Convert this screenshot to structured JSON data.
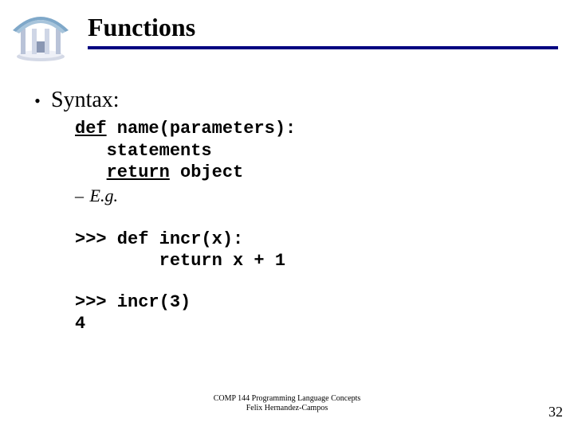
{
  "title": "Functions",
  "bullet": "•",
  "syntax_label": "Syntax:",
  "code": {
    "def": "def",
    "sig": " name(parameters):",
    "stmts": "statements",
    "ret": "return",
    "obj": " object"
  },
  "eg_dash": "–",
  "eg_label": "E.g.",
  "repl1": {
    "l1": ">>> def incr(x):",
    "l2": "        return x + 1"
  },
  "repl2": {
    "l1": ">>> incr(3)",
    "l2": "4"
  },
  "footer": {
    "l1": "COMP 144 Programming Language Concepts",
    "l2": "Felix Hernandez-Campos"
  },
  "pagenum": "32"
}
